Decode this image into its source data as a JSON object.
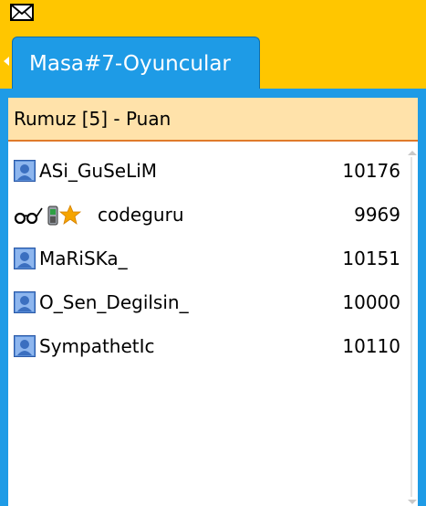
{
  "top_bar": {
    "mail_icon": "envelope-icon",
    "background": "#FFC600"
  },
  "tab": {
    "label": "Masa#7-Oyuncular",
    "color": "#1E9BE6"
  },
  "players": {
    "header": "Rumuz [5] - Puan",
    "rows": [
      {
        "name": "ASi_GuSeLiM",
        "score": "10176",
        "icon": "user-avatar-icon"
      },
      {
        "name": "codeguru",
        "score": "9969",
        "icon": "glasses-phone-star-icons"
      },
      {
        "name": "MaRiSKa_",
        "score": "10151",
        "icon": "user-avatar-icon"
      },
      {
        "name": "O_Sen_Degilsin_",
        "score": "10000",
        "icon": "user-avatar-icon"
      },
      {
        "name": "SympathetIc",
        "score": "10110",
        "icon": "user-avatar-icon"
      }
    ]
  }
}
